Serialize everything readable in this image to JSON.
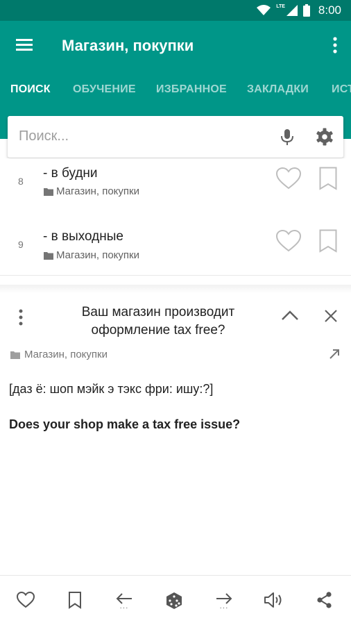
{
  "status_bar": {
    "time": "8:00",
    "network": "LTE"
  },
  "app_bar": {
    "title": "Магазин, покупки"
  },
  "tabs": [
    {
      "label": "ПОИСК",
      "active": true
    },
    {
      "label": "ОБУЧЕНИЕ",
      "active": false
    },
    {
      "label": "ИЗБРАННОЕ",
      "active": false
    },
    {
      "label": "ЗАКЛАДКИ",
      "active": false
    },
    {
      "label": "ИСТ",
      "active": false
    }
  ],
  "search": {
    "placeholder": "Поиск..."
  },
  "list": [
    {
      "number": "8",
      "text": "- в будни",
      "category": "Магазин, покупки"
    },
    {
      "number": "9",
      "text": "- в выходные",
      "category": "Магазин, покупки"
    }
  ],
  "detail": {
    "title": "Ваш магазин производит оформление tax free?",
    "category": "Магазин, покупки",
    "transcription": "[даз ё: шоп мэйк э тэкс фри: ишу:?]",
    "translation": "Does your shop make a tax free issue?"
  },
  "colors": {
    "primary": "#009688",
    "primary_dark": "#00796b",
    "icon_gray": "#757575"
  },
  "bottom_bar": {
    "icons": [
      "heart-icon",
      "bookmark-icon",
      "arrow-left-icon",
      "dice-icon",
      "arrow-right-icon",
      "speaker-icon",
      "share-icon"
    ]
  }
}
